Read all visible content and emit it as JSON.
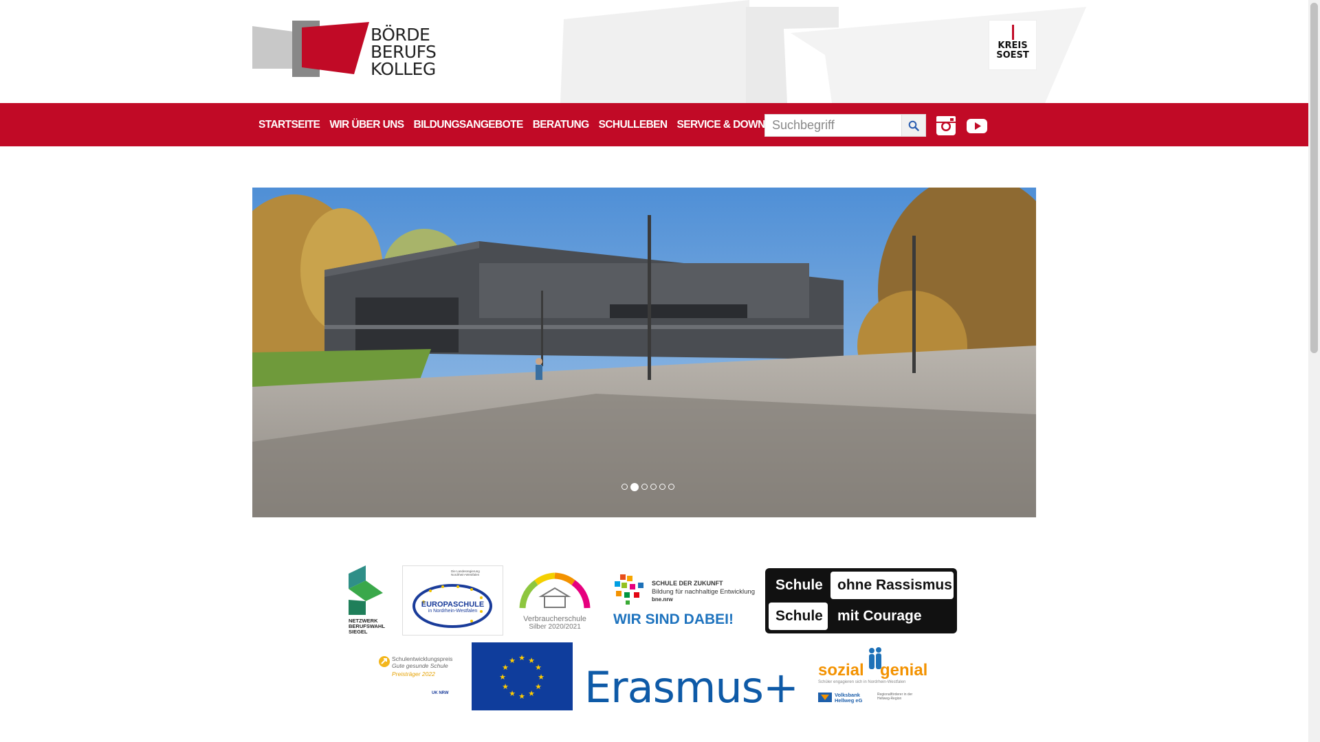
{
  "header": {
    "logo_lines": [
      "BÖRDE",
      "BERUFS",
      "KOLLEG"
    ],
    "kreis_lines": [
      "KREIS",
      "SOEST"
    ]
  },
  "nav": {
    "items": [
      {
        "label": "STARTSEITE"
      },
      {
        "label": "WIR ÜBER UNS"
      },
      {
        "label": "BILDUNGSANGEBOTE"
      },
      {
        "label": "BERATUNG"
      },
      {
        "label": "SCHULLEBEN"
      },
      {
        "label": "SERVICE & DOWNLOAD"
      }
    ],
    "search": {
      "placeholder": "Suchbegriff",
      "value": ""
    }
  },
  "slider": {
    "slide_count": 6,
    "active_index": 1
  },
  "partners": {
    "netzwerk": [
      "NETZWERK",
      "BERUFSWAHL",
      "SIEGEL"
    ],
    "europaschule_top": "Die Landesregierung Nordrhein-Westfalen",
    "europaschule": [
      "EUROPASCHULE",
      "in Nordrhein-Westfalen"
    ],
    "verbraucher": [
      "Verbraucherschule",
      "Silber 2020/2021"
    ],
    "zukunft": {
      "title": "SCHULE DER ZUKUNFT",
      "sub": "Bildung für nachhaltige Entwicklung",
      "bne": "bne.nrw",
      "claim": "WIR SIND DABEI!"
    },
    "rassismus": {
      "row1_left": "Schule",
      "row1_right": "ohne Rassismus",
      "row2_left": "Schule",
      "row2_right": "mit Courage"
    },
    "entwicklung": [
      "Schulentwicklungspreis",
      "Gute gesunde Schule",
      "Preisträger 2022",
      "UK NRW"
    ],
    "erasmus": "Erasmus+",
    "sozial": {
      "word1": "sozial",
      "word2": "genial",
      "sub": "Schüler engagieren sich in Nordrhein-Westfalen",
      "bank": "Volksbank Hellweg eG",
      "bank_note": "Regionalförderer in der Hellweg-Region"
    }
  },
  "colors": {
    "brand_red": "#c10a26",
    "eu_blue": "#1a3c9a",
    "erasmus_blue": "#0e5aa7"
  }
}
